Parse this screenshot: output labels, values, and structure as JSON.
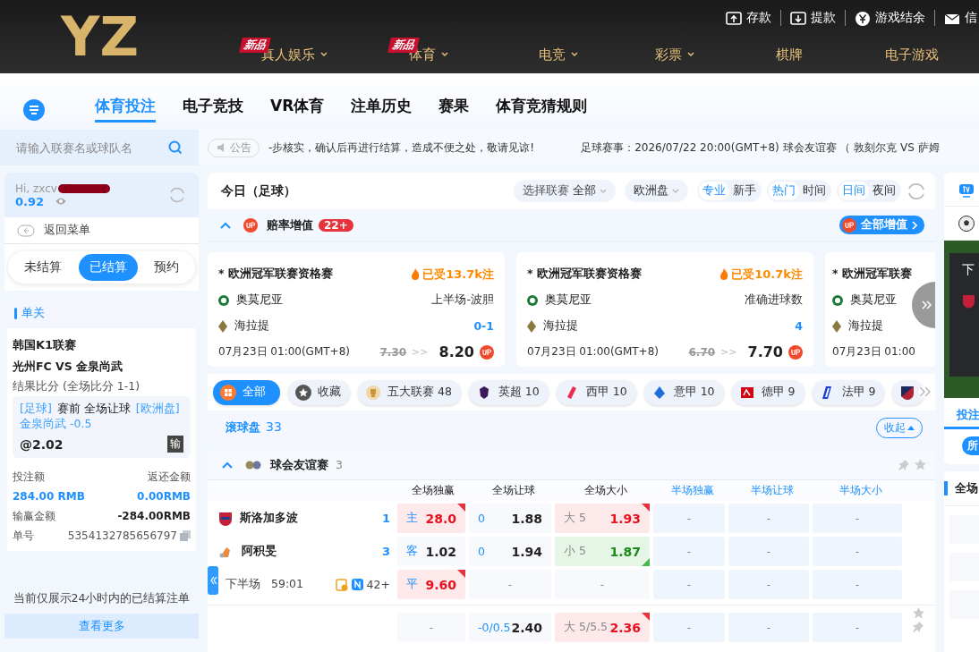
{
  "header": {
    "logo": "YZ",
    "links": [
      {
        "label": "存款"
      },
      {
        "label": "提款"
      },
      {
        "label": "游戏结余"
      },
      {
        "label": "信"
      }
    ],
    "nav": [
      {
        "label": "真人娱乐",
        "badge": "新品",
        "dropdown": true
      },
      {
        "label": "体育",
        "badge": "新品",
        "dropdown": true
      },
      {
        "label": "电竞",
        "dropdown": true
      },
      {
        "label": "彩票",
        "dropdown": true
      },
      {
        "label": "棋牌",
        "dropdown": false
      },
      {
        "label": "电子游戏",
        "dropdown": false
      }
    ]
  },
  "tabs": [
    {
      "label": "体育投注",
      "selected": true
    },
    {
      "label": "电子竞技",
      "selected": false
    },
    {
      "label": "VR体育",
      "selected": false
    },
    {
      "label": "注单历史",
      "selected": false
    },
    {
      "label": "赛果",
      "selected": false
    },
    {
      "label": "体育竞猜规则",
      "selected": false
    }
  ],
  "search": {
    "placeholder": "请输入联赛名或球队名"
  },
  "notice": {
    "label": "公告",
    "text": "-步核实，确认后再进行结算，造成不便之处，敬请见谅!",
    "event": "足球赛事：2026/07/22 20:00(GMT+8) 球会友谊赛 （ 敦刻尔克 VS 萨姆"
  },
  "account": {
    "greeting": "Hi, zxcv",
    "balance": "0.92",
    "back": "返回菜单"
  },
  "bet_tabs": [
    {
      "label": "未结算",
      "selected": false
    },
    {
      "label": "已结算",
      "selected": true
    },
    {
      "label": "预约",
      "selected": false
    }
  ],
  "bet": {
    "section": "单关",
    "league": "韩国K1联赛",
    "match": "光州FC VS 金泉尚武",
    "result": "结果比分 (全场比分 1-1)",
    "sport": "[足球]",
    "type": "赛前 全场让球",
    "market": "[欧洲盘]",
    "selection": "金泉尚武 -0.5",
    "odds": "@2.02",
    "outcome": "输",
    "rows": [
      {
        "label": "投注额",
        "value": "返还金额",
        "kind": "head"
      },
      {
        "label": "284.00 RMB",
        "value": "0.00RMB",
        "kind": "amount"
      },
      {
        "label": "输赢金额",
        "value": "-284.00RMB",
        "kind": "total"
      },
      {
        "label": "单号",
        "value": "5354132785656797",
        "kind": "id"
      }
    ]
  },
  "bet_note": "当前仅展示24小时内的已结算注单",
  "more": "查看更多",
  "panel": {
    "title": "今日（足球）",
    "league_select": {
      "label": "选择联赛",
      "value": "全部"
    },
    "odds_select": {
      "value": "欧洲盘"
    },
    "toggles": [
      [
        {
          "label": "专业",
          "selected": true
        },
        {
          "label": "新手",
          "selected": false
        }
      ],
      [
        {
          "label": "热门",
          "selected": true
        },
        {
          "label": "时间",
          "selected": false
        }
      ],
      [
        {
          "label": "日间",
          "selected": true
        },
        {
          "label": "夜间",
          "selected": false
        }
      ]
    ]
  },
  "boost": {
    "title": "赔率增值",
    "count": "22+",
    "button": "全部增值",
    "expanded": true,
    "cards": [
      {
        "league": "* 欧洲冠军联赛资格赛",
        "hot": "已受13.7k注",
        "home": "奥莫尼亚",
        "away": "海拉提",
        "market": "上半场-波胆",
        "pick": "0-1",
        "time": "07月23日  01:00(GMT+8)",
        "old": "7.30",
        "arrow": ">>",
        "new": "8.20"
      },
      {
        "league": "* 欧洲冠军联赛资格赛",
        "hot": "已受10.7k注",
        "home": "奥莫尼亚",
        "away": "海拉提",
        "market": "准确进球数",
        "pick": "4",
        "time": "07月23日  01:00(GMT+8)",
        "old": "6.70",
        "arrow": ">>",
        "new": "7.70"
      },
      {
        "league": "* 欧洲冠军联赛",
        "home": "奥莫尼亚",
        "away": "海拉提",
        "time": "07月23日  01:00"
      }
    ]
  },
  "chips": [
    {
      "label": "全部",
      "selected": true
    },
    {
      "label": "收藏",
      "selected": false
    },
    {
      "label": "五大联赛 48",
      "selected": false
    },
    {
      "label": "英超 10",
      "selected": false
    },
    {
      "label": "西甲 10",
      "selected": false
    },
    {
      "label": "意甲 10",
      "selected": false
    },
    {
      "label": "德甲 9",
      "selected": false
    },
    {
      "label": "法甲 9",
      "selected": false
    },
    {
      "selected": false
    }
  ],
  "live": {
    "title": "滚球盘",
    "count": "33",
    "collapse": "收起"
  },
  "league": {
    "name": "球会友谊赛",
    "count": "3",
    "expanded": true
  },
  "columns": [
    {
      "label": "全场独赢",
      "kind": "full"
    },
    {
      "label": "全场让球",
      "kind": "full"
    },
    {
      "label": "全场大小",
      "kind": "full"
    },
    {
      "label": "半场独赢",
      "kind": "half"
    },
    {
      "label": "半场让球",
      "kind": "half"
    },
    {
      "label": "半场大小",
      "kind": "half"
    }
  ],
  "matches": [
    {
      "home": "斯洛加多波",
      "home_score": "1",
      "away": "阿积旻",
      "away_score": "3",
      "period": "下半场",
      "clock": "59:01",
      "markets": "42+",
      "rows": [
        [
          {
            "kind": "odds",
            "label": "主",
            "odds": "28.0",
            "up": true,
            "down": false
          },
          {
            "kind": "odds",
            "label": "0",
            "odds": "1.88",
            "up": false,
            "down": false
          },
          {
            "kind": "total",
            "label": "大 5",
            "odds": "1.93",
            "up": true,
            "down": false
          },
          {
            "kind": "empty",
            "text": "-"
          },
          {
            "kind": "empty",
            "text": "-"
          },
          {
            "kind": "empty",
            "text": "-"
          }
        ],
        [
          {
            "kind": "odds",
            "label": "客",
            "odds": "1.02",
            "up": false,
            "down": false
          },
          {
            "kind": "odds",
            "label": "0",
            "odds": "1.94",
            "up": false,
            "down": false
          },
          {
            "kind": "total",
            "label": "小 5",
            "odds": "1.87",
            "up": false,
            "down": true
          },
          {
            "kind": "empty",
            "text": "-"
          },
          {
            "kind": "empty",
            "text": "-"
          },
          {
            "kind": "empty",
            "text": "-"
          }
        ],
        [
          {
            "kind": "odds",
            "label": "平",
            "odds": "9.60",
            "up": true,
            "down": false
          },
          {
            "kind": "empty",
            "text": "-"
          },
          {
            "kind": "empty",
            "text": "-"
          },
          {
            "kind": "empty",
            "text": "-"
          },
          {
            "kind": "empty",
            "text": "-"
          },
          {
            "kind": "empty",
            "text": "-"
          }
        ]
      ]
    },
    {
      "rows": [
        [
          {
            "kind": "empty",
            "text": "-"
          },
          {
            "kind": "odds",
            "label": "-0/0.5",
            "odds": "2.40",
            "up": false,
            "down": false
          },
          {
            "kind": "total",
            "label": "大 5/5.5",
            "odds": "2.36",
            "up": true,
            "down": false
          },
          {
            "kind": "empty",
            "text": "-"
          },
          {
            "kind": "empty",
            "text": "-"
          },
          {
            "kind": "empty",
            "text": "-"
          }
        ]
      ]
    }
  ],
  "side": {
    "video": {
      "caption": "下"
    },
    "tab": {
      "label": "投注",
      "selected": true
    },
    "chip": "所",
    "section": "全场"
  }
}
